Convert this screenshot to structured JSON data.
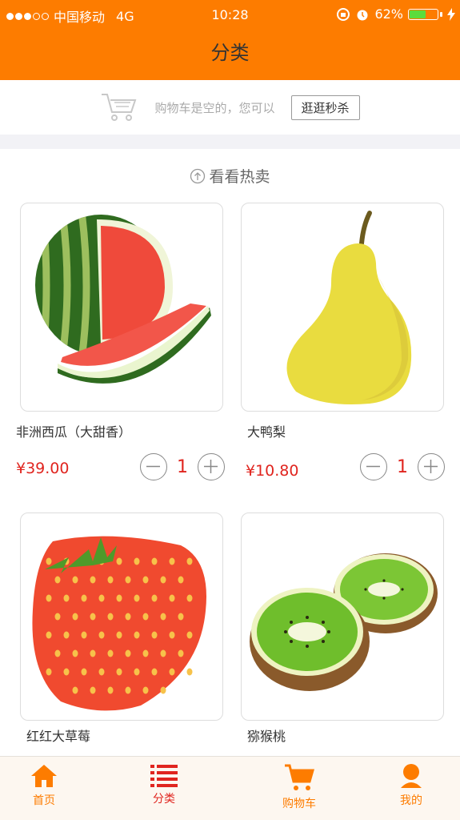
{
  "status_bar": {
    "carrier": "中国移动",
    "network": "4G",
    "time": "10:28",
    "battery": "62%",
    "battery_level": 0.62
  },
  "header": {
    "title": "分类"
  },
  "cart_empty": {
    "message": "购物车是空的，您可以",
    "action": "逛逛秒杀"
  },
  "hot": {
    "title": "看看热卖"
  },
  "products": [
    {
      "name": "非洲西瓜（大甜香）",
      "price": "¥39.00",
      "qty": "1",
      "image": "watermelon"
    },
    {
      "name": "大鸭梨",
      "price": "¥10.80",
      "qty": "1",
      "image": "pear"
    },
    {
      "name": "红红大草莓",
      "image": "strawberry"
    },
    {
      "name": "猕猴桃",
      "image": "kiwi"
    }
  ],
  "tabs": [
    {
      "label": "首页",
      "icon": "home-icon"
    },
    {
      "label": "分类",
      "icon": "list-icon"
    },
    {
      "label": "购物车",
      "icon": "cart-icon"
    },
    {
      "label": "我的",
      "icon": "user-icon"
    }
  ],
  "colors": {
    "brand": "#fd7c00",
    "price": "#e0251f"
  }
}
